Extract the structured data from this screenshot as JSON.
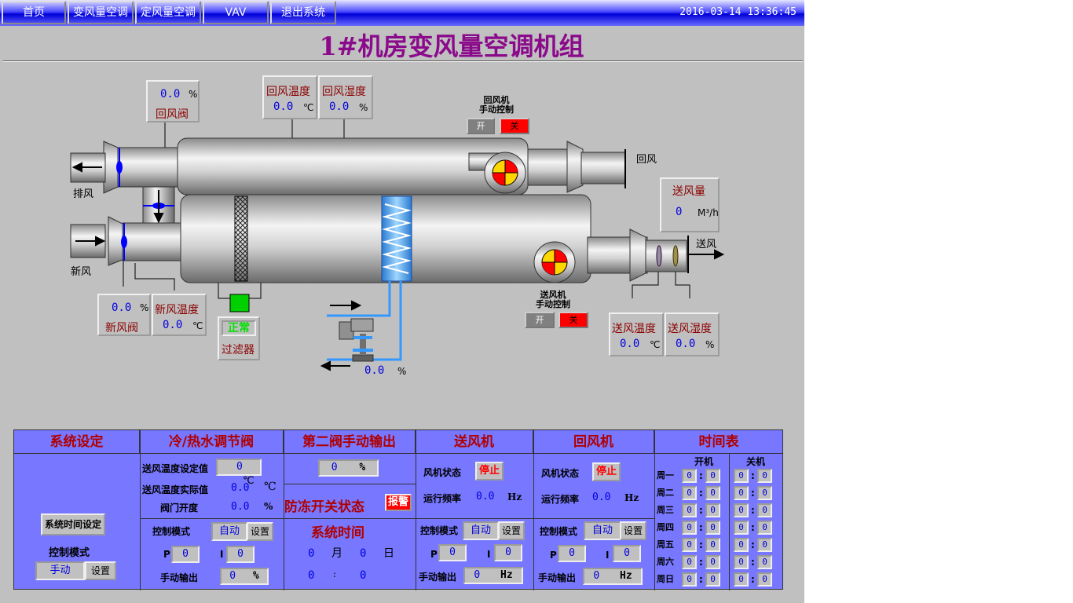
{
  "nav": {
    "home": "首页",
    "vav_ac": "变风量空调",
    "cav_ac": "定风量空调",
    "vav": "VAV",
    "exit": "退出系统",
    "datetime": "2016-03-14 13:36:45"
  },
  "title": "1#机房变风量空调机组",
  "return_damper": {
    "value": "0.0",
    "unit": "%",
    "label": "回风阀"
  },
  "return_temp": {
    "label": "回风温度",
    "value": "0.0",
    "unit": "℃"
  },
  "return_humid": {
    "label": "回风湿度",
    "value": "0.0",
    "unit": "%"
  },
  "return_fan_ctrl": {
    "line1": "回风机",
    "line2": "手动控制",
    "on": "开",
    "off": "关"
  },
  "supply_fan_ctrl": {
    "line1": "送风机",
    "line2": "手动控制",
    "on": "开",
    "off": "关"
  },
  "labels": {
    "exhaust": "排风",
    "fresh": "新风",
    "return": "回风",
    "supply": "送风"
  },
  "supply_volume": {
    "label": "送风量",
    "value": "0",
    "unit": "M³/h"
  },
  "fresh_damper": {
    "value": "0.0",
    "unit": "%",
    "label": "新风阀"
  },
  "fresh_temp": {
    "label": "新风温度",
    "value": "0.0",
    "unit": "℃"
  },
  "filter": {
    "status": "正常",
    "label": "过滤器"
  },
  "valve": {
    "value": "0.0",
    "unit": "%"
  },
  "supply_temp": {
    "label": "送风温度",
    "value": "0.0",
    "unit": "℃"
  },
  "supply_humid": {
    "label": "送风湿度",
    "value": "0.0",
    "unit": "%"
  },
  "bottom": {
    "sys": {
      "header": "系统设定",
      "time_btn": "系统时间设定",
      "mode_label": "控制模式",
      "mode": "手动",
      "set": "设置"
    },
    "valve": {
      "header": "冷/热水调节阀",
      "sp_label": "送风温度设定值",
      "sp_value": "0",
      "sp_unit": "℃",
      "act_label": "送风温度实际值",
      "act_value": "0.0",
      "act_unit": "℃",
      "open_label": "阀门开度",
      "open_value": "0.0",
      "open_unit": "%",
      "mode_label": "控制模式",
      "mode": "自动",
      "set": "设置",
      "p_label": "P",
      "p_value": "0",
      "i_label": "I",
      "i_value": "0",
      "manual_label": "手动输出",
      "manual_value": "0",
      "manual_unit": "%"
    },
    "second": {
      "header": "第二阀手动输出",
      "value": "0",
      "unit": "%",
      "freeze_label": "防冻开关状态",
      "alarm": "报警",
      "systime_label": "系统时间",
      "month": "0",
      "month_unit": "月",
      "day": "0",
      "day_unit": "日",
      "hour": "0",
      "colon": ":",
      "minute": "0"
    },
    "supply_fan": {
      "header": "送风机",
      "status_label": "风机状态",
      "status": "停止",
      "freq_label": "运行频率",
      "freq": "0.0",
      "freq_unit": "Hz",
      "mode_label": "控制模式",
      "mode": "自动",
      "set": "设置",
      "p_label": "P",
      "p_value": "0",
      "i_label": "I",
      "i_value": "0",
      "manual_label": "手动输出",
      "manual_value": "0",
      "manual_unit": "Hz"
    },
    "return_fan": {
      "header": "回风机",
      "status_label": "风机状态",
      "status": "停止",
      "freq_label": "运行频率",
      "freq": "0.0",
      "freq_unit": "Hz",
      "mode_label": "控制模式",
      "mode": "自动",
      "set": "设置",
      "p_label": "P",
      "p_value": "0",
      "i_label": "I",
      "i_value": "0",
      "manual_label": "手动输出",
      "manual_value": "0",
      "manual_unit": "Hz"
    },
    "schedule": {
      "header": "时间表",
      "on_label": "开机",
      "off_label": "关机",
      "days": [
        {
          "day": "周一",
          "on_h": "0",
          "on_m": "0",
          "off_h": "0",
          "off_m": "0"
        },
        {
          "day": "周二",
          "on_h": "0",
          "on_m": "0",
          "off_h": "0",
          "off_m": "0"
        },
        {
          "day": "周三",
          "on_h": "0",
          "on_m": "0",
          "off_h": "0",
          "off_m": "0"
        },
        {
          "day": "周四",
          "on_h": "0",
          "on_m": "0",
          "off_h": "0",
          "off_m": "0"
        },
        {
          "day": "周五",
          "on_h": "0",
          "on_m": "0",
          "off_h": "0",
          "off_m": "0"
        },
        {
          "day": "周六",
          "on_h": "0",
          "on_m": "0",
          "off_h": "0",
          "off_m": "0"
        },
        {
          "day": "周日",
          "on_h": "0",
          "on_m": "0",
          "off_h": "0",
          "off_m": "0"
        }
      ],
      "sep": ":"
    }
  }
}
